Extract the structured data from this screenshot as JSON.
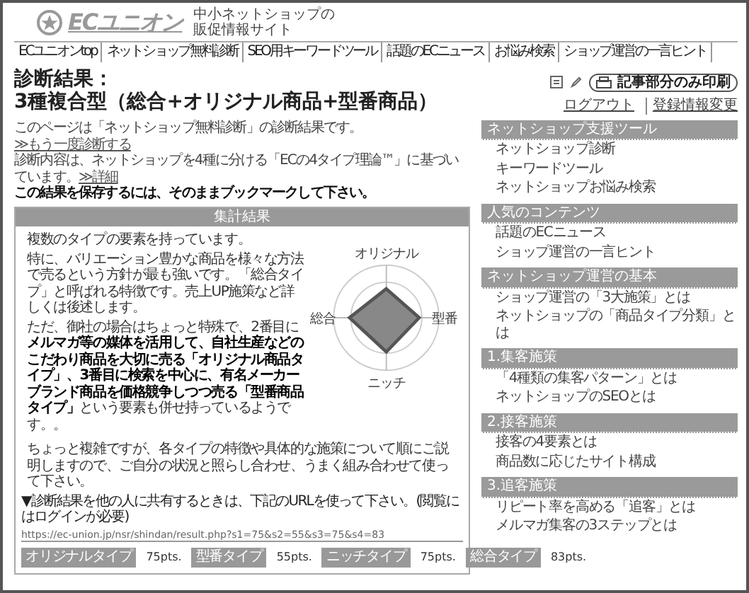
{
  "site": {
    "logo": "ECユニオン",
    "tagline": [
      "中小ネットショップの",
      "販促情報サイト"
    ]
  },
  "nav": [
    "ECユニオンtop",
    "ネットショップ無料診断",
    "SEO用キーワードツール",
    "話題のECニュース",
    "お悩み検索",
    "ショップ運営の一言ヒント"
  ],
  "page": {
    "title": "診断結果：",
    "subtitle": "3種複合型（総合+オリジナル商品+型番商品）"
  },
  "intro": [
    {
      "text": "このページは「ネットショップ無料診断」の診断結果です。",
      "link": "≫もう一度診断する",
      "bold": false
    },
    {
      "text": "診断内容は、ネットショップを4種に分ける「ECの4タイプ理論™」に基づいています。",
      "link": "≫詳細",
      "bold": false
    },
    {
      "text": "この結果を保存するには、そのままブックマークして下さい。",
      "bold": true
    }
  ],
  "results_panel": {
    "header": "集計結果",
    "summary": "複数のタイプの要素を持っています。",
    "paragraphs": [
      "特に、バリエーション豊かな商品を様々な方法で売るという方針が最も強いです。「総合タイプ」と呼ばれる特徴です。売上UP施策など詳しくは後述します。",
      "ただ、御社の場合はちょっと特殊で、2番目に**メルマガ等の媒体を活用して、自社生産などのこだわり商品を大切に売る「オリジナル商品タイプ」、3番目に検索を中心に、有名メーカーブランド商品を価格競争しつつ売る「型番商品タイプ」**という要素も併せ持っているようです。。"
    ],
    "radar_labels": {
      "top": "オリジナル",
      "right": "型番",
      "bottom": "ニッチ",
      "left": "総合"
    },
    "note": "ちょっと複雑ですが、各タイプの特徴や具体的な施策について順にご説明しますので、ご自分の状況と照らし合わせ、うまく組み合わせて使って下さい。",
    "share_label": "▼診断結果を他の人に共有するときは、下記のURLを使って下さい。(閲覧にはログインが必要)",
    "share_url": "https://ec-union.jp/nsr/shindan/result.php?s1=75&s2=55&s3=75&s4=83",
    "scores": [
      {
        "type": "オリジナルタイプ",
        "points": "75pts."
      },
      {
        "type": "型番タイプ",
        "points": "55pts."
      },
      {
        "type": "ニッチタイプ",
        "points": "75pts."
      },
      {
        "type": "総合タイプ",
        "points": "83pts."
      }
    ]
  },
  "sidebar": {
    "print_button": "記事部分のみ印刷",
    "account_links": [
      "ログアウト",
      "登録情報変更"
    ],
    "sections": [
      {
        "title": "ネットショップ支援ツール",
        "items": [
          "ネットショップ診断",
          "キーワードツール",
          "ネットショップお悩み検索"
        ]
      },
      {
        "title": "人気のコンテンツ",
        "items": [
          "話題のECニュース",
          "ショップ運営の一言ヒント"
        ]
      },
      {
        "title": "ネットショップ運営の基本",
        "items": [
          "ショップ運営の「3大施策」とは",
          "ネットショップの「商品タイプ分類」とは"
        ]
      },
      {
        "title": "1.集客施策",
        "items": [
          "「4種類の集客パターン」とは",
          "ネットショップのSEOとは"
        ]
      },
      {
        "title": "2.接客施策",
        "items": [
          "接客の4要素とは",
          "商品数に応じたサイト構成"
        ]
      },
      {
        "title": "3.追客施策",
        "items": [
          "リピート率を高める「追客」とは",
          "メルマガ集客の3ステップとは"
        ]
      }
    ]
  }
}
